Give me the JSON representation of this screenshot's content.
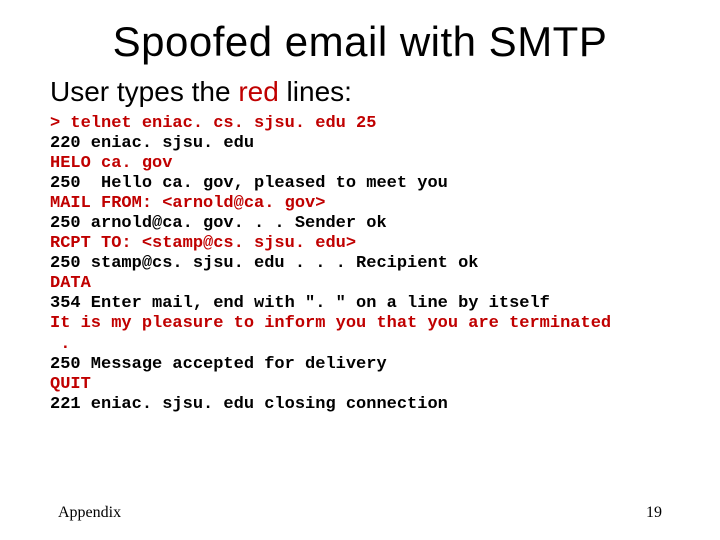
{
  "title": "Spoofed email with SMTP",
  "subtitle_prefix": "User types the ",
  "subtitle_red": "red",
  "subtitle_suffix": " lines:",
  "lines": [
    {
      "text": "> telnet eniac. cs. sjsu. edu 25",
      "red": true
    },
    {
      "text": "220 eniac. sjsu. edu",
      "red": false
    },
    {
      "text": "HELO ca. gov",
      "red": true
    },
    {
      "text": "250  Hello ca. gov, pleased to meet you",
      "red": false
    },
    {
      "text": "MAIL FROM: <arnold@ca. gov>",
      "red": true
    },
    {
      "text": "250 arnold@ca. gov. . . Sender ok",
      "red": false
    },
    {
      "text": "RCPT TO: <stamp@cs. sjsu. edu>",
      "red": true
    },
    {
      "text": "250 stamp@cs. sjsu. edu . . . Recipient ok",
      "red": false
    },
    {
      "text": "DATA",
      "red": true
    },
    {
      "text": "354 Enter mail, end with \". \" on a line by itself",
      "red": false
    },
    {
      "text": "It is my pleasure to inform you that you are terminated",
      "red": true
    },
    {
      "text": " .",
      "red": true
    },
    {
      "text": "250 Message accepted for delivery",
      "red": false
    },
    {
      "text": "QUIT",
      "red": true
    },
    {
      "text": "221 eniac. sjsu. edu closing connection",
      "red": false
    }
  ],
  "footer_left": "Appendix",
  "footer_right": "19"
}
